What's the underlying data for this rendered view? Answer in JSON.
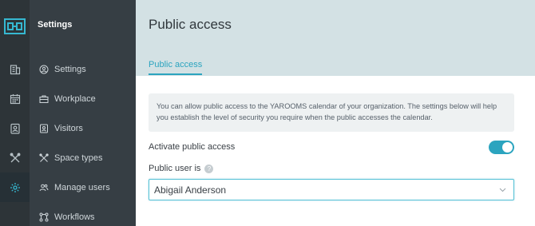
{
  "app": {
    "title": "Settings"
  },
  "rail": {
    "items": [
      {
        "icon": "building-icon",
        "active": false
      },
      {
        "icon": "calendar-icon",
        "active": false
      },
      {
        "icon": "visitor-badge-icon",
        "active": false
      },
      {
        "icon": "tools-icon",
        "active": false
      },
      {
        "icon": "gear-icon",
        "active": true
      }
    ]
  },
  "sidebar": {
    "items": [
      {
        "label": "Settings",
        "icon": "user-circle-icon"
      },
      {
        "label": "Workplace",
        "icon": "briefcase-icon"
      },
      {
        "label": "Visitors",
        "icon": "visitor-badge-icon"
      },
      {
        "label": "Space types",
        "icon": "tools-icon"
      },
      {
        "label": "Manage users",
        "icon": "users-icon"
      },
      {
        "label": "Workflows",
        "icon": "workflow-icon"
      }
    ]
  },
  "page": {
    "title": "Public access",
    "tab": "Public access",
    "info": "You can allow public access to the YAROOMS calendar of your organization. The settings below will help you establish the level of security you require when the public accesses the calendar.",
    "activate_label": "Activate public access",
    "activate_on": true,
    "public_user_label": "Public user is",
    "help_symbol": "?",
    "public_user_value": "Abigail Anderson"
  },
  "colors": {
    "accent": "#2ba4bf",
    "rail": "#2d3438",
    "sidebar": "#363e44",
    "header": "#d3e1e4"
  }
}
